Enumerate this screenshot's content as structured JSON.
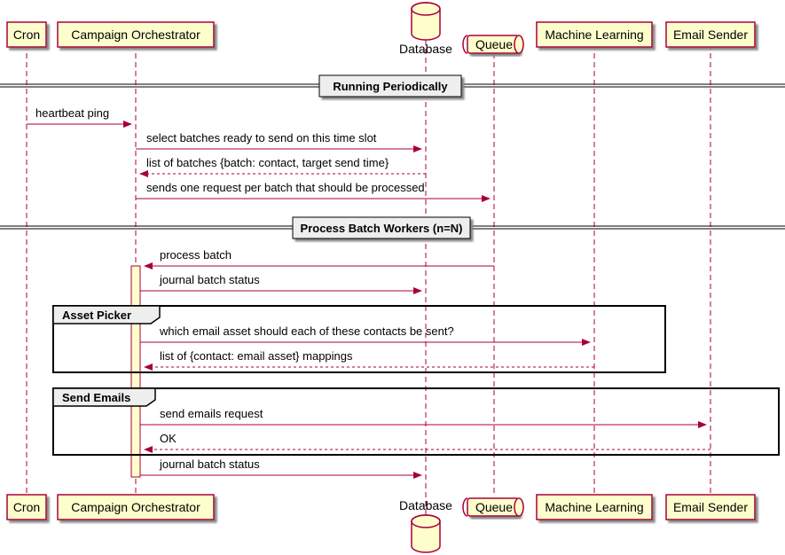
{
  "participants": {
    "cron": "Cron",
    "orchestrator": "Campaign Orchestrator",
    "database": "Database",
    "queue": "Queue",
    "ml": "Machine Learning",
    "sender": "Email Sender"
  },
  "dividers": {
    "running": "Running Periodically",
    "workers": "Process Batch Workers (n=N)"
  },
  "groups": {
    "asset_picker": "Asset Picker",
    "send_emails": "Send Emails"
  },
  "messages": {
    "m1": "heartbeat ping",
    "m2": "select batches ready to send on this time slot",
    "m3": "list of batches {batch: contact, target send time}",
    "m4": "sends one request per batch that should be processed",
    "m5": "process batch",
    "m6": "journal batch status",
    "m7": "which email asset should each of these contacts be sent?",
    "m8": "list of {contact: email asset} mappings",
    "m9": "send emails request",
    "m10": "OK",
    "m11": "journal batch status"
  },
  "chart_data": {
    "type": "sequence_diagram",
    "participants": [
      "Cron",
      "Campaign Orchestrator",
      "Database",
      "Queue",
      "Machine Learning",
      "Email Sender"
    ],
    "segments": [
      {
        "divider": "Running Periodically"
      },
      {
        "from": "Cron",
        "to": "Campaign Orchestrator",
        "label": "heartbeat ping"
      },
      {
        "from": "Campaign Orchestrator",
        "to": "Database",
        "label": "select batches ready to send on this time slot"
      },
      {
        "from": "Database",
        "to": "Campaign Orchestrator",
        "label": "list of batches {batch: contact, target send time}"
      },
      {
        "from": "Campaign Orchestrator",
        "to": "Queue",
        "label": "sends one request per batch that should be processed"
      },
      {
        "divider": "Process Batch Workers (n=N)"
      },
      {
        "from": "Queue",
        "to": "Campaign Orchestrator",
        "label": "process batch"
      },
      {
        "from": "Campaign Orchestrator",
        "to": "Database",
        "label": "journal batch status"
      },
      {
        "group": "Asset Picker",
        "messages": [
          {
            "from": "Campaign Orchestrator",
            "to": "Machine Learning",
            "label": "which email asset should each of these contacts be sent?"
          },
          {
            "from": "Machine Learning",
            "to": "Campaign Orchestrator",
            "label": "list of {contact: email asset} mappings"
          }
        ]
      },
      {
        "group": "Send Emails",
        "messages": [
          {
            "from": "Campaign Orchestrator",
            "to": "Email Sender",
            "label": "send emails request"
          },
          {
            "from": "Email Sender",
            "to": "Campaign Orchestrator",
            "label": "OK"
          }
        ]
      },
      {
        "from": "Campaign Orchestrator",
        "to": "Database",
        "label": "journal batch status"
      }
    ]
  }
}
